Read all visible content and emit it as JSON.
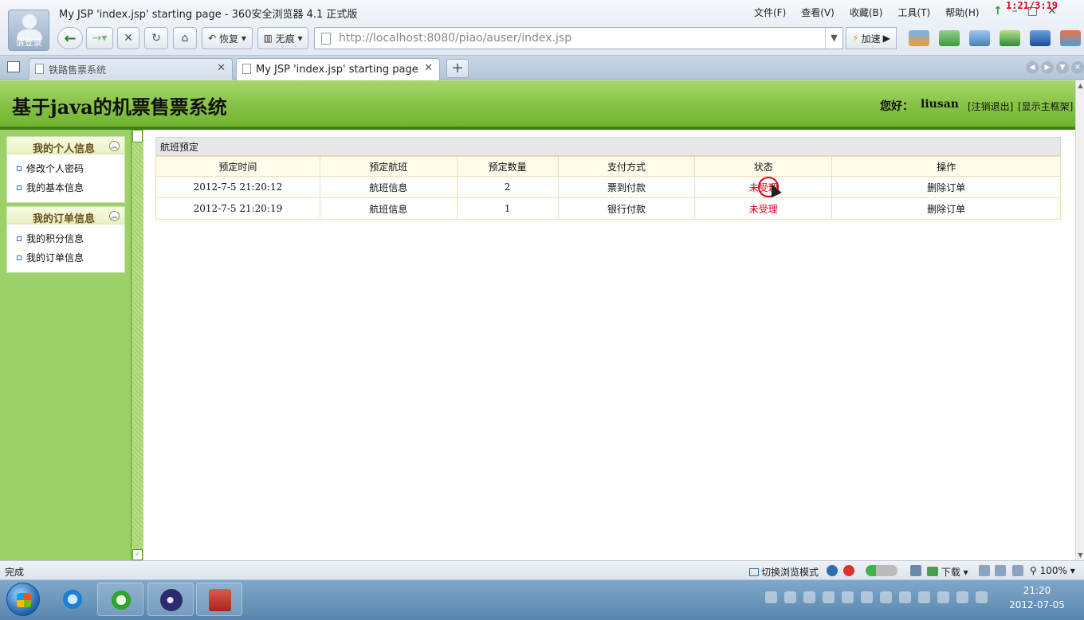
{
  "browser": {
    "window_title": "My JSP 'index.jsp' starting page - 360安全浏览器 4.1 正式版",
    "login_label": "请登录",
    "menu": [
      "文件(F)",
      "查看(V)",
      "收藏(B)",
      "工具(T)",
      "帮助(H)"
    ],
    "recording_timer": "1:21/3:19",
    "restore_label": "恢复",
    "trace_label": "无痕",
    "url": "http://localhost:8080/piao/auser/index.jsp",
    "speed_label": "加速",
    "tabs": [
      {
        "title": "铁路售票系统",
        "active": false
      },
      {
        "title": "My JSP 'index.jsp' starting page",
        "active": true
      }
    ]
  },
  "site": {
    "title": "基于java的机票售票系统",
    "greeting": "您好：",
    "username": "liusan",
    "logout_label": "[注销退出]",
    "show_frame_label": "[显示主框架]"
  },
  "sidebar": {
    "blocks": [
      {
        "title": "我的个人信息",
        "items": [
          "修改个人密码",
          "我的基本信息"
        ]
      },
      {
        "title": "我的订单信息",
        "items": [
          "我的积分信息",
          "我的订单信息"
        ]
      }
    ]
  },
  "orders": {
    "panel_title": "航班预定",
    "columns": [
      "预定时间",
      "预定航班",
      "预定数量",
      "支付方式",
      "状态",
      "操作"
    ],
    "rows": [
      {
        "time": "2012-7-5 21:20:12",
        "flight": "航班信息",
        "qty": "2",
        "payment": "票到付款",
        "status": "未受理",
        "action": "删除订单"
      },
      {
        "time": "2012-7-5 21:20:19",
        "flight": "航班信息",
        "qty": "1",
        "payment": "银行付款",
        "status": "未受理",
        "action": "删除订单"
      }
    ]
  },
  "statusbar": {
    "status_text": "完成",
    "switch_mode_label": "切换浏览模式",
    "download_label": "下载",
    "zoom": "100%"
  },
  "taskbar": {
    "time": "21:20",
    "date": "2012-07-05"
  },
  "colors": {
    "banner_green": "#86c246",
    "sidebar_green": "#9cd16a",
    "status_red": "#d1001c"
  }
}
